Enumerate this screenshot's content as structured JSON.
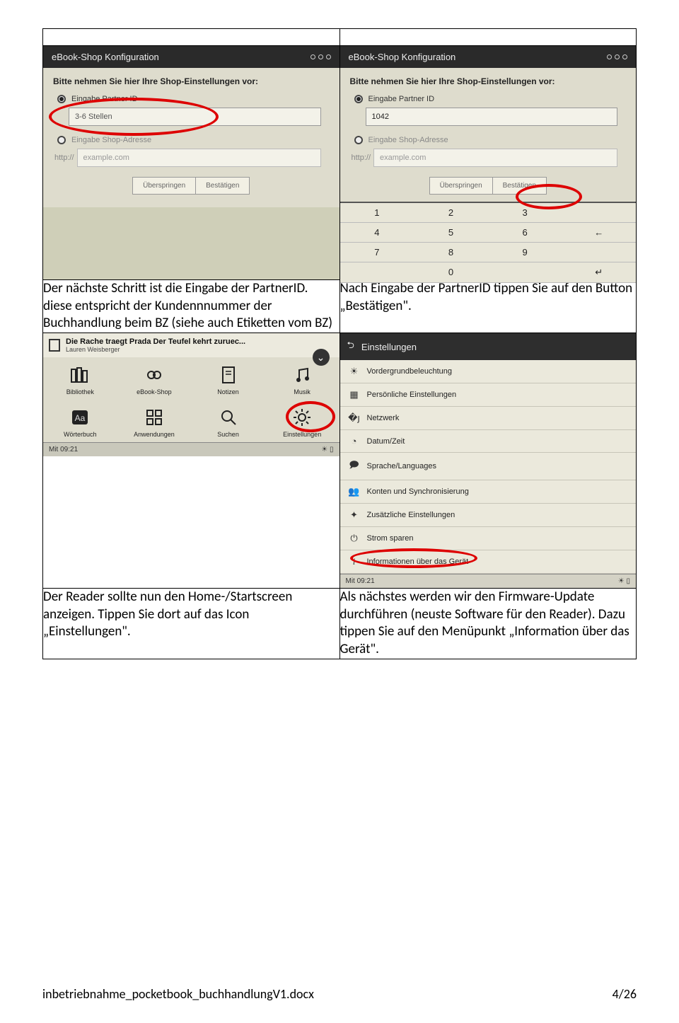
{
  "row1": {
    "left": {
      "title": "eBook-Shop Konfiguration",
      "instr": "Bitte nehmen Sie hier Ihre  Shop-Einstellungen vor:",
      "opt1": "Eingabe Partner ID",
      "field1": "3-6 Stellen",
      "opt2": "Eingabe Shop-Adresse",
      "proto": "http://",
      "domain": "example.com",
      "btn_skip": "Überspringen",
      "btn_ok": "Bestätigen"
    },
    "right": {
      "title": "eBook-Shop Konfiguration",
      "instr": "Bitte nehmen Sie hier Ihre  Shop-Einstellungen vor:",
      "opt1": "Eingabe Partner ID",
      "field1": "1042",
      "opt2": "Eingabe Shop-Adresse",
      "proto": "http://",
      "domain": "example.com",
      "btn_skip": "Überspringen",
      "btn_ok": "Bestätigen",
      "keys": [
        "1",
        "2",
        "3",
        "",
        "4",
        "5",
        "6",
        "←",
        "7",
        "8",
        "9",
        "",
        "",
        "0",
        "",
        "↵"
      ]
    }
  },
  "row1text": {
    "left": "Der nächste Schritt ist die Eingabe der PartnerID. diese entspricht der Kundennnummer der Buchhandlung beim BZ (siehe auch Etiketten vom BZ)",
    "right": "Nach Eingabe der PartnerID tippen Sie auf den Button „Bestätigen\"."
  },
  "row2": {
    "home": {
      "book_title": "Die Rache traegt Prada Der Teufel kehrt zuruec...",
      "book_author": "Lauren Weisberger",
      "items": [
        "Bibliothek",
        "eBook-Shop",
        "Notizen",
        "Musik",
        "Wörterbuch",
        "Anwendungen",
        "Suchen",
        "Einstellungen"
      ],
      "time": "Mit 09:21"
    },
    "settings": {
      "title": "Einstellungen",
      "items": [
        "Vordergrundbeleuchtung",
        "Persönliche Einstellungen",
        "Netzwerk",
        "Datum/Zeit",
        "Sprache/Languages",
        "Konten und Synchronisierung",
        "Zusätzliche Einstellungen",
        "Strom sparen",
        "Informationen über das Gerät"
      ],
      "time": "Mit 09:21"
    }
  },
  "row2text": {
    "left": "Der Reader sollte nun den Home-/Startscreen anzeigen. Tippen Sie dort auf das Icon „Einstellungen\".",
    "right": "Als nächstes werden wir den Firmware-Update durchführen (neuste Software für den Reader). Dazu tippen Sie auf den Menüpunkt „Information über das Gerät\"."
  },
  "footer": {
    "file": "inbetriebnahme_pocketbook_buchhandlungV1.docx",
    "page": "4/26"
  }
}
